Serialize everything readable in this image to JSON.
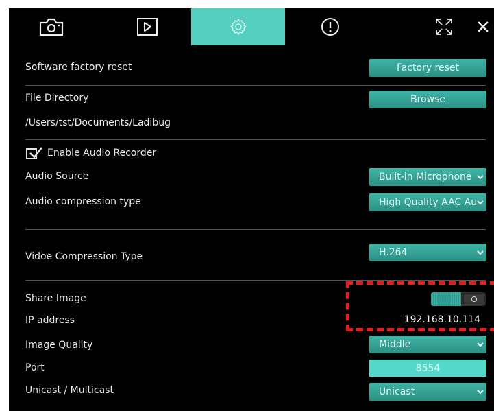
{
  "toolbar": {
    "items": [
      {
        "name": "camera-icon",
        "active": false
      },
      {
        "name": "play-icon",
        "active": false
      },
      {
        "name": "gear-icon",
        "active": true
      },
      {
        "name": "info-icon",
        "active": false
      }
    ],
    "accent_color": "#55cfc0"
  },
  "factory": {
    "label": "Software factory reset",
    "button": "Factory reset"
  },
  "file_directory": {
    "label": "File Directory",
    "button": "Browse",
    "path": "/Users/tst/Documents/Ladibug"
  },
  "audio": {
    "enable_label": "Enable Audio Recorder",
    "enabled": true,
    "source_label": "Audio Source",
    "source_value": "Built-in Microphone",
    "compression_label": "Audio compression type",
    "compression_value": "High Quality AAC Au"
  },
  "video": {
    "compression_label": "Vidoe Compression Type",
    "compression_value": "H.264"
  },
  "share": {
    "share_label": "Share Image",
    "share_on": true,
    "ip_label": "IP address",
    "ip_value": "192.168.10.114",
    "quality_label": "Image Quality",
    "quality_value": "Middle",
    "port_label": "Port",
    "port_value": "8554",
    "cast_label": "Unicast / Multicast",
    "cast_value": "Unicast"
  }
}
